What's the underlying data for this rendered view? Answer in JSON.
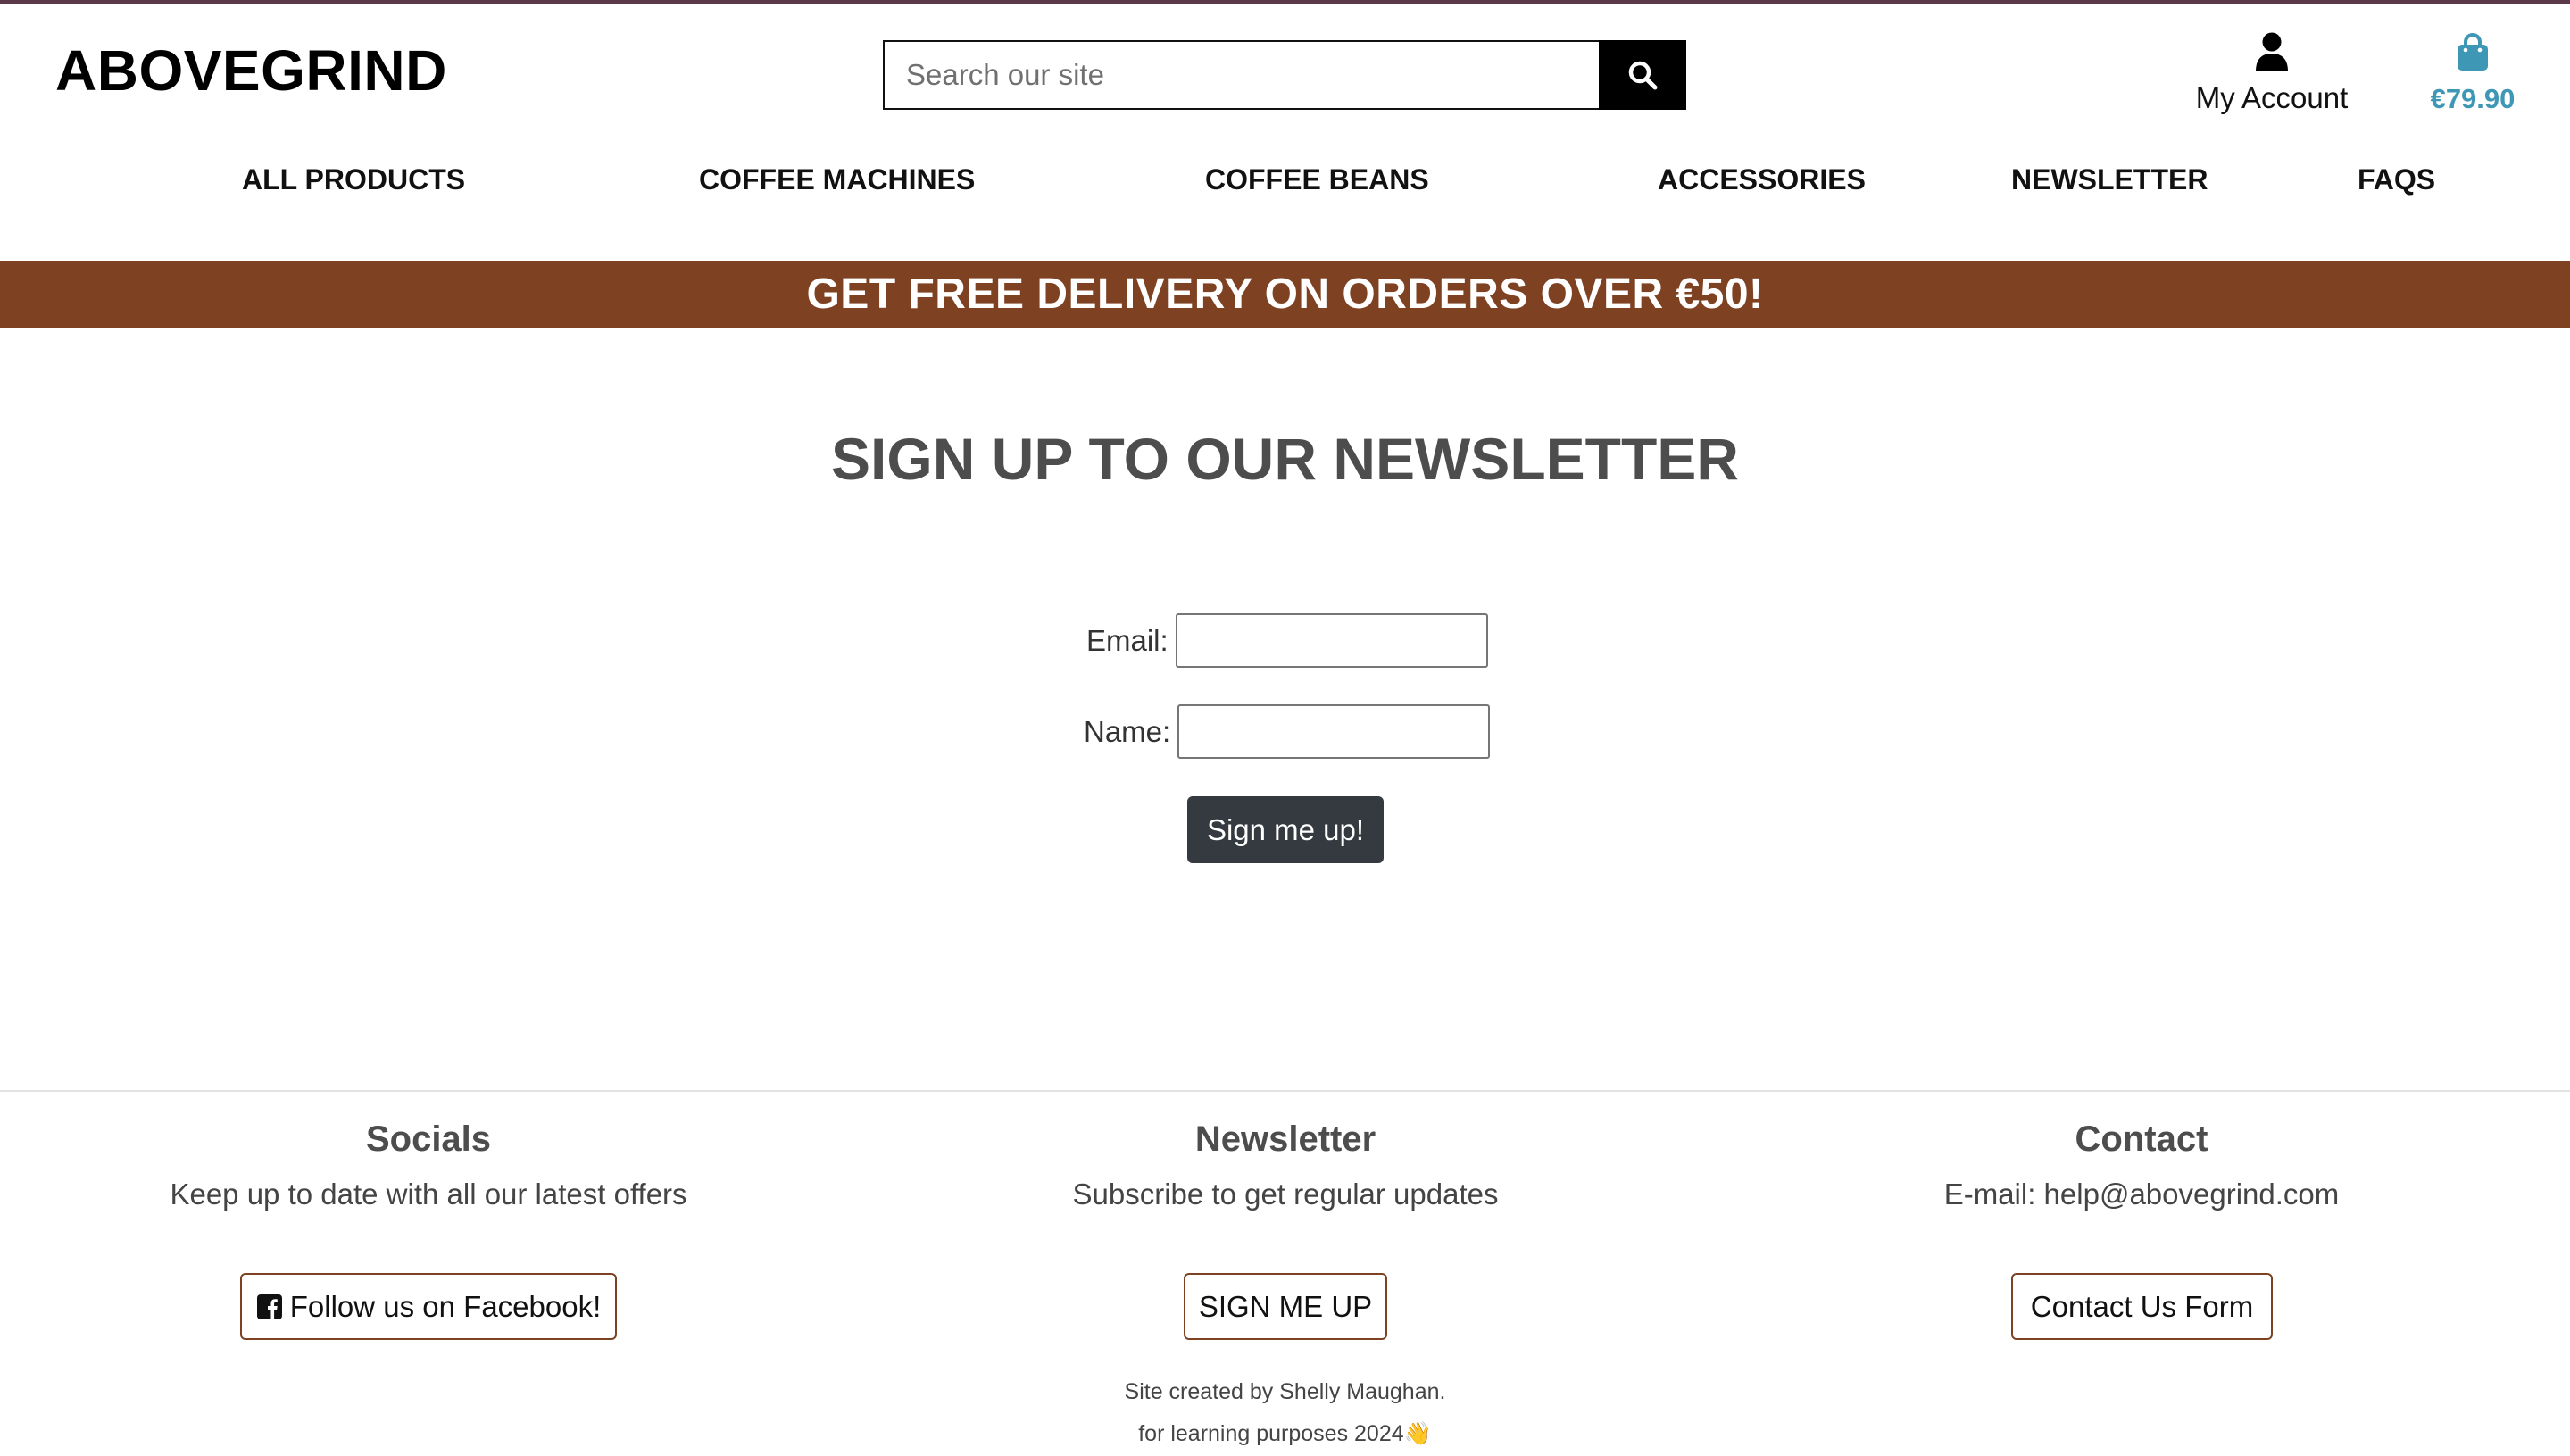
{
  "header": {
    "logo": "ABOVEGRIND",
    "search": {
      "placeholder": "Search our site",
      "value": ""
    },
    "account_label": "My Account",
    "bag_total": "€79.90"
  },
  "nav": {
    "items": [
      {
        "label": "ALL PRODUCTS"
      },
      {
        "label": "COFFEE MACHINES"
      },
      {
        "label": "COFFEE BEANS"
      },
      {
        "label": "ACCESSORIES"
      },
      {
        "label": "NEWSLETTER"
      },
      {
        "label": "FAQS"
      }
    ]
  },
  "banner": {
    "text": "GET FREE DELIVERY ON ORDERS OVER €50!"
  },
  "main": {
    "title": "SIGN UP TO OUR NEWSLETTER",
    "form": {
      "email_label": "Email:",
      "email_value": "",
      "name_label": "Name:",
      "name_value": "",
      "submit_label": "Sign me up!"
    }
  },
  "footer": {
    "socials": {
      "heading": "Socials",
      "text": "Keep up to date with all our latest offers",
      "button": "Follow us on Facebook!"
    },
    "newsletter": {
      "heading": "Newsletter",
      "text": "Subscribe to get regular updates",
      "button": "SIGN ME UP"
    },
    "contact": {
      "heading": "Contact",
      "text": "E-mail: help@abovegrind.com",
      "button": "Contact Us Form"
    },
    "credit_line1": "Site created by Shelly Maughan.",
    "credit_line2": "for learning purposes 2024👋"
  },
  "colors": {
    "brand_brown": "#7e4222",
    "bag_blue": "#3f97b6",
    "button_dark": "#343a40"
  },
  "icons": [
    "search-icon",
    "user-icon",
    "shopping-bag-icon",
    "facebook-icon"
  ]
}
